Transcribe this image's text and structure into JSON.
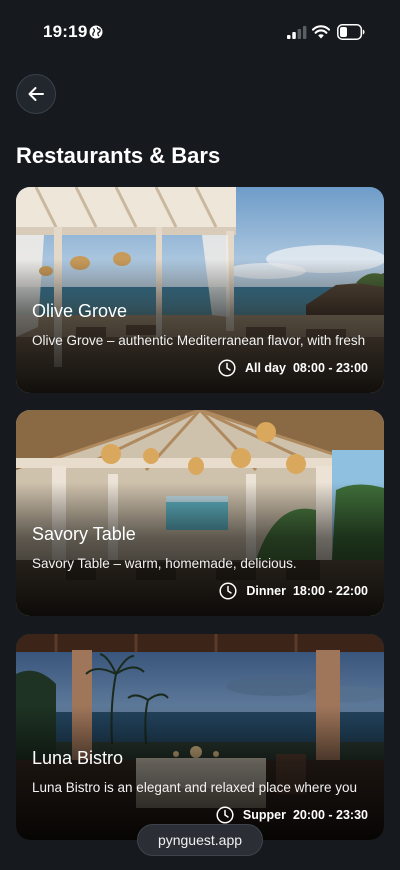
{
  "status_bar": {
    "time": "19:19"
  },
  "header": {
    "title": "Restaurants & Bars"
  },
  "venues": [
    {
      "name": "Olive Grove",
      "description": "Olive Grove – authentic Mediterranean flavor, with fresh",
      "meal_label": "All day",
      "hours": "08:00 - 23:00"
    },
    {
      "name": "Savory Table",
      "description": "Savory Table – warm, homemade, delicious.",
      "meal_label": "Dinner",
      "hours": "18:00 - 22:00"
    },
    {
      "name": "Luna Bistro",
      "description": "Luna Bistro is an elegant and relaxed place where you",
      "meal_label": "Supper",
      "hours": "20:00 - 23:30"
    }
  ],
  "footer": {
    "url": "pynguest.app"
  },
  "icons": {
    "back": "arrow-left-icon",
    "clock": "clock-icon",
    "globe": "globe-icon",
    "signal": "cellular-signal-icon",
    "wifi": "wifi-icon",
    "battery": "battery-icon"
  },
  "colors": {
    "background": "#161a1f",
    "text": "#ffffff",
    "button_bg": "#22272e"
  }
}
